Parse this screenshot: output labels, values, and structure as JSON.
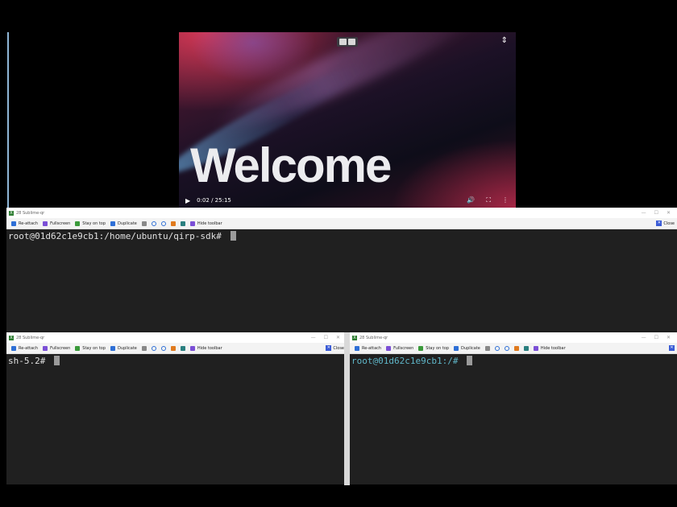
{
  "video": {
    "title_text": "Welcome",
    "time": "0:02 / 25:15",
    "play_icon": "▶",
    "volume_icon": "🔊",
    "fullscreen_icon": "⛶",
    "more_icon": "⋮",
    "sort_icon": "⇕"
  },
  "terminals": [
    {
      "title": "28 Sublime-qr",
      "prompt": "root@01d62c1e9cb1:/home/ubuntu/qirp-sdk# ",
      "prompt_color": "#e0e0e0"
    },
    {
      "title": "28 Sublime-qr",
      "prompt": "sh-5.2# ",
      "prompt_color": "#e0e0e0"
    },
    {
      "title": "28 Sublime-qr",
      "prompt": "root@01d62c1e9cb1:/# ",
      "prompt_color": "#5fb6c8"
    }
  ],
  "toolbar": {
    "reattach": "Re-attach",
    "fullscreen": "Fullscreen",
    "stay_on_top": "Stay on top",
    "duplicate": "Duplicate",
    "hide_toolbar": "Hide toolbar",
    "close": "Close"
  }
}
